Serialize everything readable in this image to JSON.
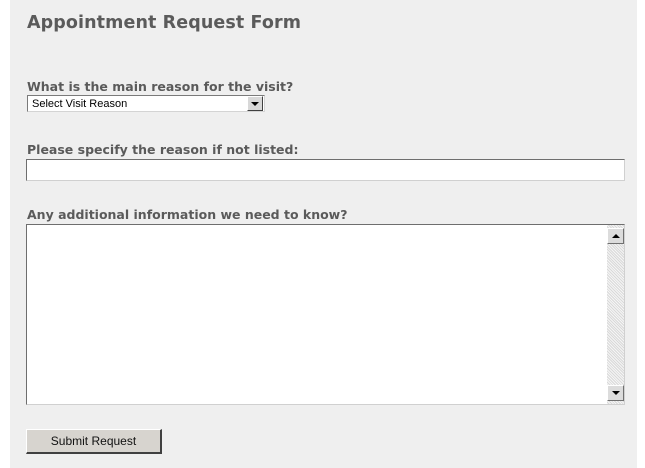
{
  "form": {
    "title": "Appointment Request Form",
    "reason_question": "What is the main reason for the visit?",
    "reason_select_value": "Select Visit Reason",
    "specify_label": "Please specify the reason if not listed:",
    "specify_value": "",
    "additional_label": "Any additional information we need to know?",
    "additional_value": "",
    "submit_label": "Submit Request"
  },
  "colors": {
    "panel_background": "#efefef",
    "label_text": "#5a5a5a",
    "button_face": "#d7d4cf"
  },
  "icons": {
    "select_dropdown": "chevron-down-icon",
    "scroll_up": "scroll-up-arrow-icon",
    "scroll_down": "scroll-down-arrow-icon"
  }
}
